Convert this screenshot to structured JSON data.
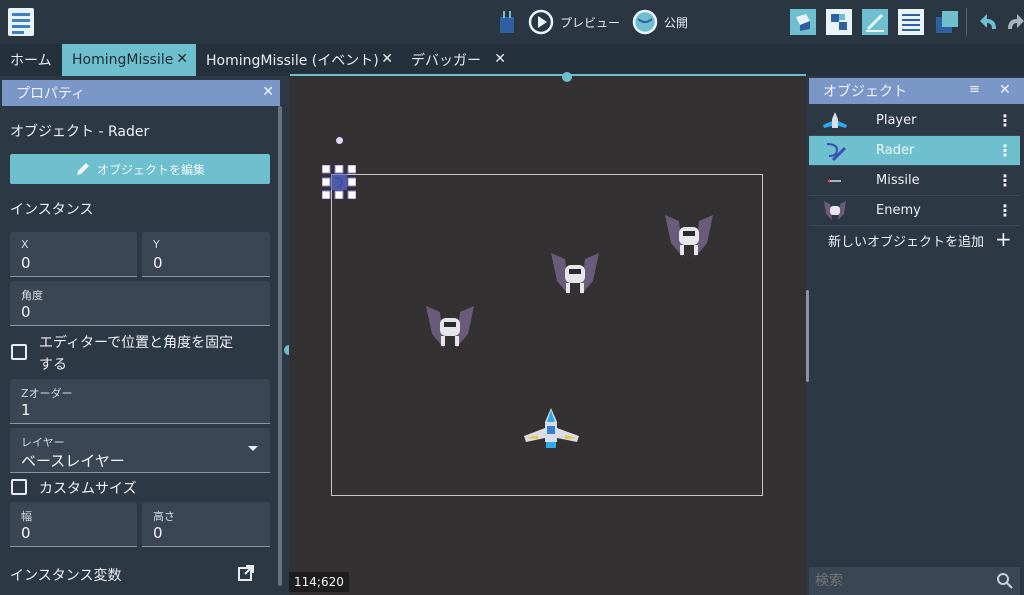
{
  "toolbar": {
    "preview_label": "プレビュー",
    "publish_label": "公開"
  },
  "tabs": [
    {
      "label": "ホーム"
    },
    {
      "label": "HomingMissile"
    },
    {
      "label": "HomingMissile (イベント)"
    },
    {
      "label": "デバッガー"
    }
  ],
  "properties": {
    "title": "プロパティ",
    "object_label": "オブジェクト - Rader",
    "edit_button": "オブジェクトを編集",
    "instance_heading": "インスタンス",
    "x_label": "X",
    "x_value": "0",
    "y_label": "Y",
    "y_value": "0",
    "angle_label": "角度",
    "angle_value": "0",
    "lock_label_line1": "エディターで位置と角度を固定",
    "lock_label_line2": "する",
    "z_label": "Zオーダー",
    "z_value": "1",
    "layer_label": "レイヤー",
    "layer_value": "ベースレイヤー",
    "custom_size_label": "カスタムサイズ",
    "width_label": "幅",
    "width_value": "0",
    "height_label": "高さ",
    "height_value": "0",
    "instance_vars": "インスタンス変数"
  },
  "canvas": {
    "coords": "114;620"
  },
  "objects": {
    "title": "オブジェクト",
    "items": [
      {
        "name": "Player"
      },
      {
        "name": "Rader"
      },
      {
        "name": "Missile"
      },
      {
        "name": "Enemy"
      }
    ],
    "add_label": "新しいオブジェクトを追加",
    "search_placeholder": "検索"
  },
  "colors": {
    "accent": "#6ec0cf",
    "panel_header": "#7a97c7",
    "canvas_bg": "#333131"
  }
}
